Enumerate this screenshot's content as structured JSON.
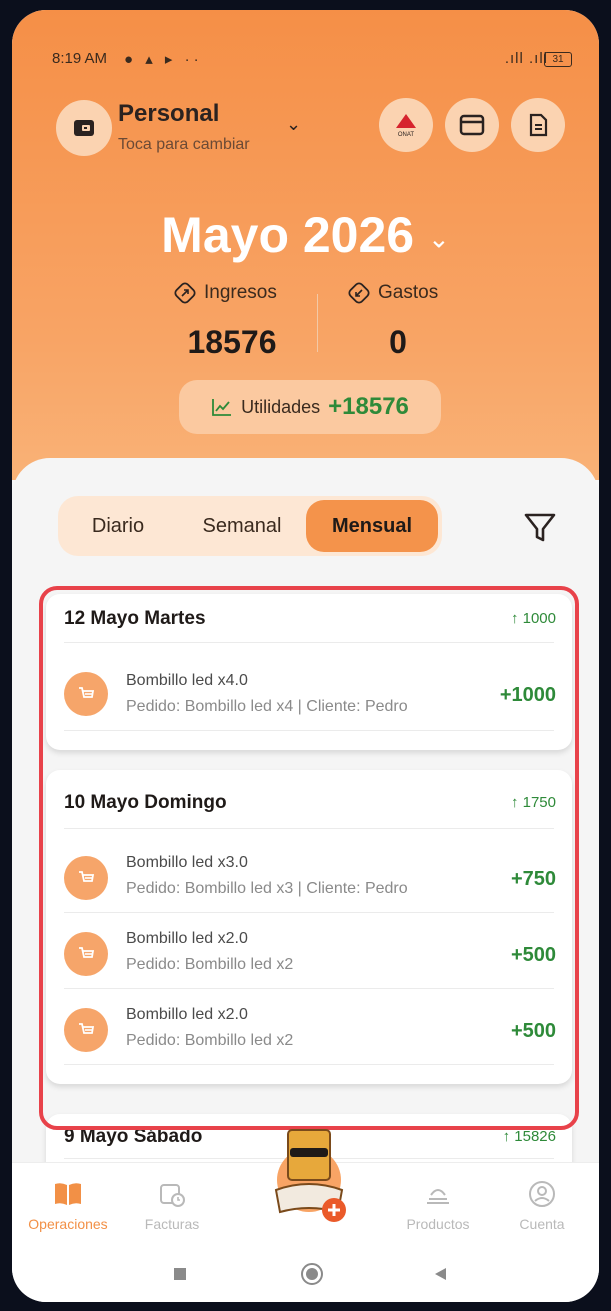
{
  "status": {
    "time": "8:19 AM",
    "battery": "31"
  },
  "account": {
    "name": "Personal",
    "subtitle": "Toca para cambiar"
  },
  "header_buttons": [
    "onat-icon",
    "card-icon",
    "document-icon"
  ],
  "header_button_text": {
    "onat": "ONAT"
  },
  "period": {
    "title": "Mayo 2026"
  },
  "summary": {
    "income_label": "Ingresos",
    "income_value": "18576",
    "expense_label": "Gastos",
    "expense_value": "0",
    "profit_label": "Utilidades",
    "profit_value": "+18576"
  },
  "segments": {
    "daily": "Diario",
    "weekly": "Semanal",
    "monthly": "Mensual",
    "selected": "Mensual"
  },
  "days": [
    {
      "title": "12 Mayo Martes",
      "total": "↑ 1000",
      "items": [
        {
          "name": "Bombillo led x4.0",
          "detail": "Pedido: Bombillo led x4 | Cliente: Pedro",
          "amount": "+1000"
        }
      ]
    },
    {
      "title": "10 Mayo Domingo",
      "total": "↑ 1750",
      "items": [
        {
          "name": "Bombillo led x3.0",
          "detail": "Pedido: Bombillo led x3 | Cliente: Pedro",
          "amount": "+750"
        },
        {
          "name": "Bombillo led x2.0",
          "detail": "Pedido: Bombillo led x2",
          "amount": "+500"
        },
        {
          "name": "Bombillo led x2.0",
          "detail": "Pedido: Bombillo led x2",
          "amount": "+500"
        }
      ]
    },
    {
      "title": "9 Mayo Sábado",
      "total": "↑ 15826",
      "items": []
    }
  ],
  "nav": {
    "operations": "Operaciones",
    "invoices": "Facturas",
    "products": "Productos",
    "account": "Cuenta",
    "active": "Operaciones"
  },
  "colors": {
    "accent": "#f4934b",
    "positive": "#2e8a39",
    "highlight": "#e8424a"
  }
}
